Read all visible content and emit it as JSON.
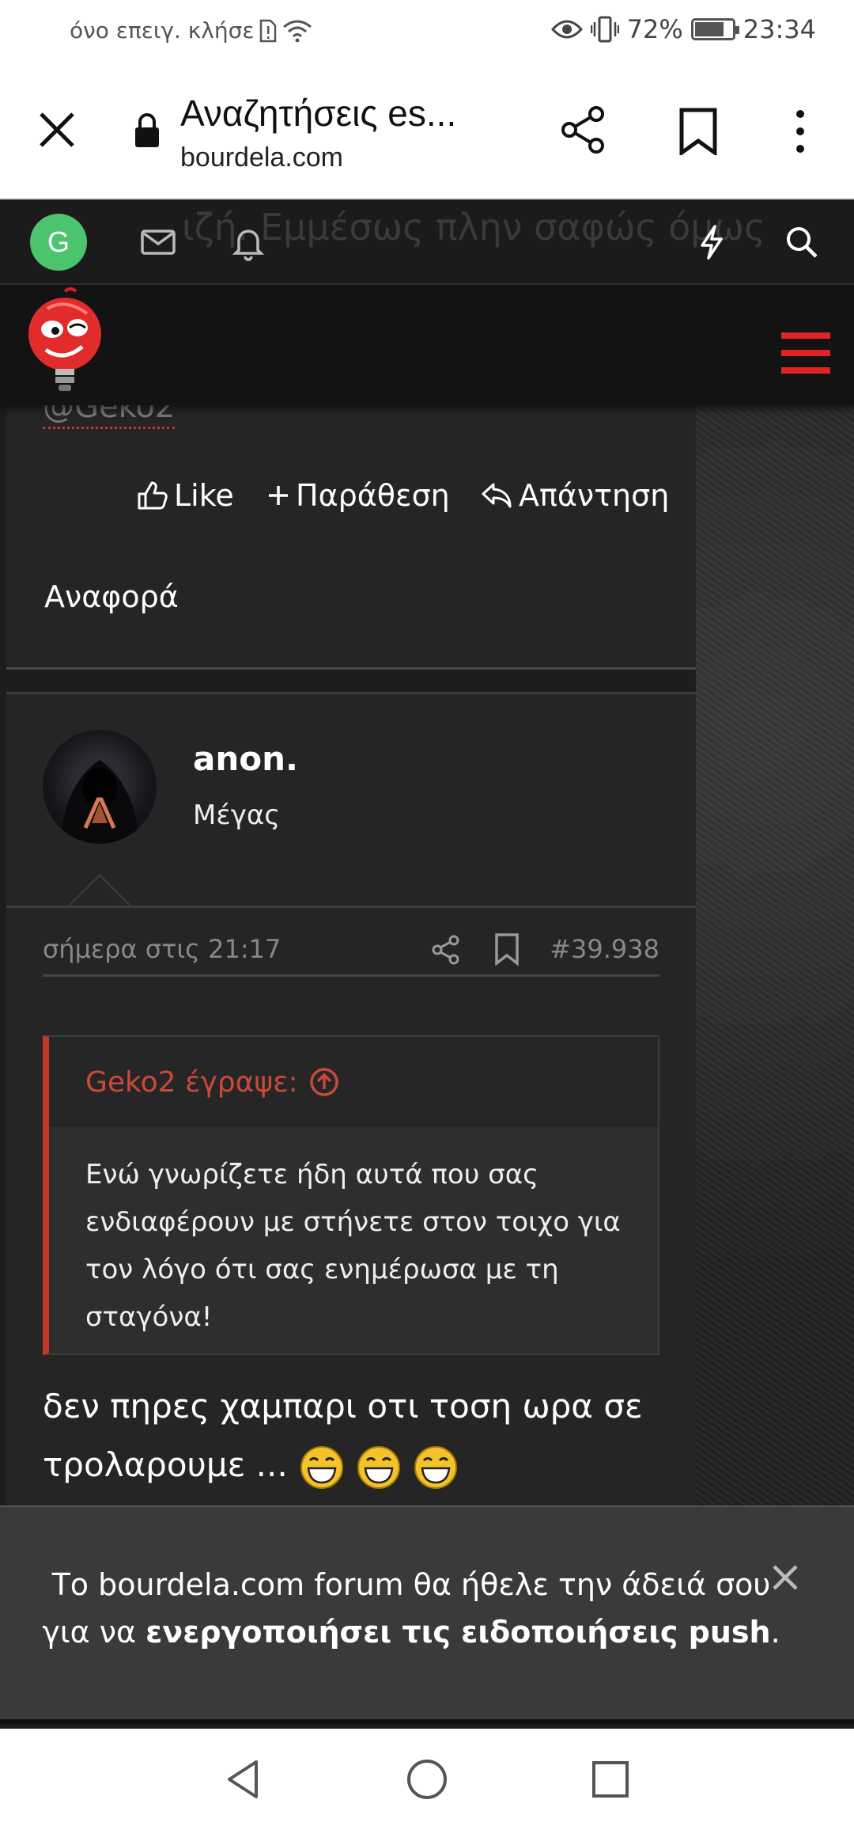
{
  "status": {
    "carrier_text": "όνο επειγ. κλήσε",
    "battery_percent": "72%",
    "battery_level": 0.72,
    "time": "23:34"
  },
  "browser": {
    "title": "Αναζητήσεις es...",
    "url": "bourdela.com"
  },
  "forum_nav": {
    "user_initial": "G",
    "background_ghost_text": "ιζή. Εμμέσως πλην σαφώς όμως"
  },
  "previous_post": {
    "mention": "@Geko2",
    "like_label": "Like",
    "quote_label": "Παράθεση",
    "reply_label": "Απάντηση",
    "report_label": "Αναφορά"
  },
  "post": {
    "username": "anon.",
    "user_title": "Μέγας",
    "date": "σήμερα στις 21:17",
    "post_number": "#39.938",
    "quote_author": "Geko2 έγραψε:",
    "quote_text": "Ενώ γνωρίζετε ήδη αυτά που σας ενδιαφέρουν με στήνετε στον τοιχο για τον λόγο ότι σας ενημέρωσα με τη σταγόνα!",
    "body_text": "δεν πηρες χαμπαρι οτι τοση ωρα σε τρολαρουμε ..."
  },
  "notice": {
    "text_before": "Το bourdela.com forum θα ήθελε την άδειά σου για να ",
    "text_bold": "ενεργοποιήσει τις ειδοποιήσεις push",
    "text_after": "."
  },
  "icons": {
    "status": [
      "eye-icon",
      "vibrate-icon",
      "battery-icon",
      "wifi-icon",
      "sim-alert-icon"
    ],
    "browser": [
      "close-icon",
      "lock-icon",
      "share-icon",
      "bookmark-icon",
      "more-vert-icon"
    ],
    "forum": [
      "mail-icon",
      "bell-icon",
      "lightning-icon",
      "search-icon",
      "menu-icon"
    ],
    "nav": [
      "back-icon",
      "home-icon",
      "recents-icon"
    ]
  },
  "colors": {
    "accent_red": "#e02424",
    "quote_author": "#c94a3a",
    "avatar_green": "#4cc46d"
  }
}
